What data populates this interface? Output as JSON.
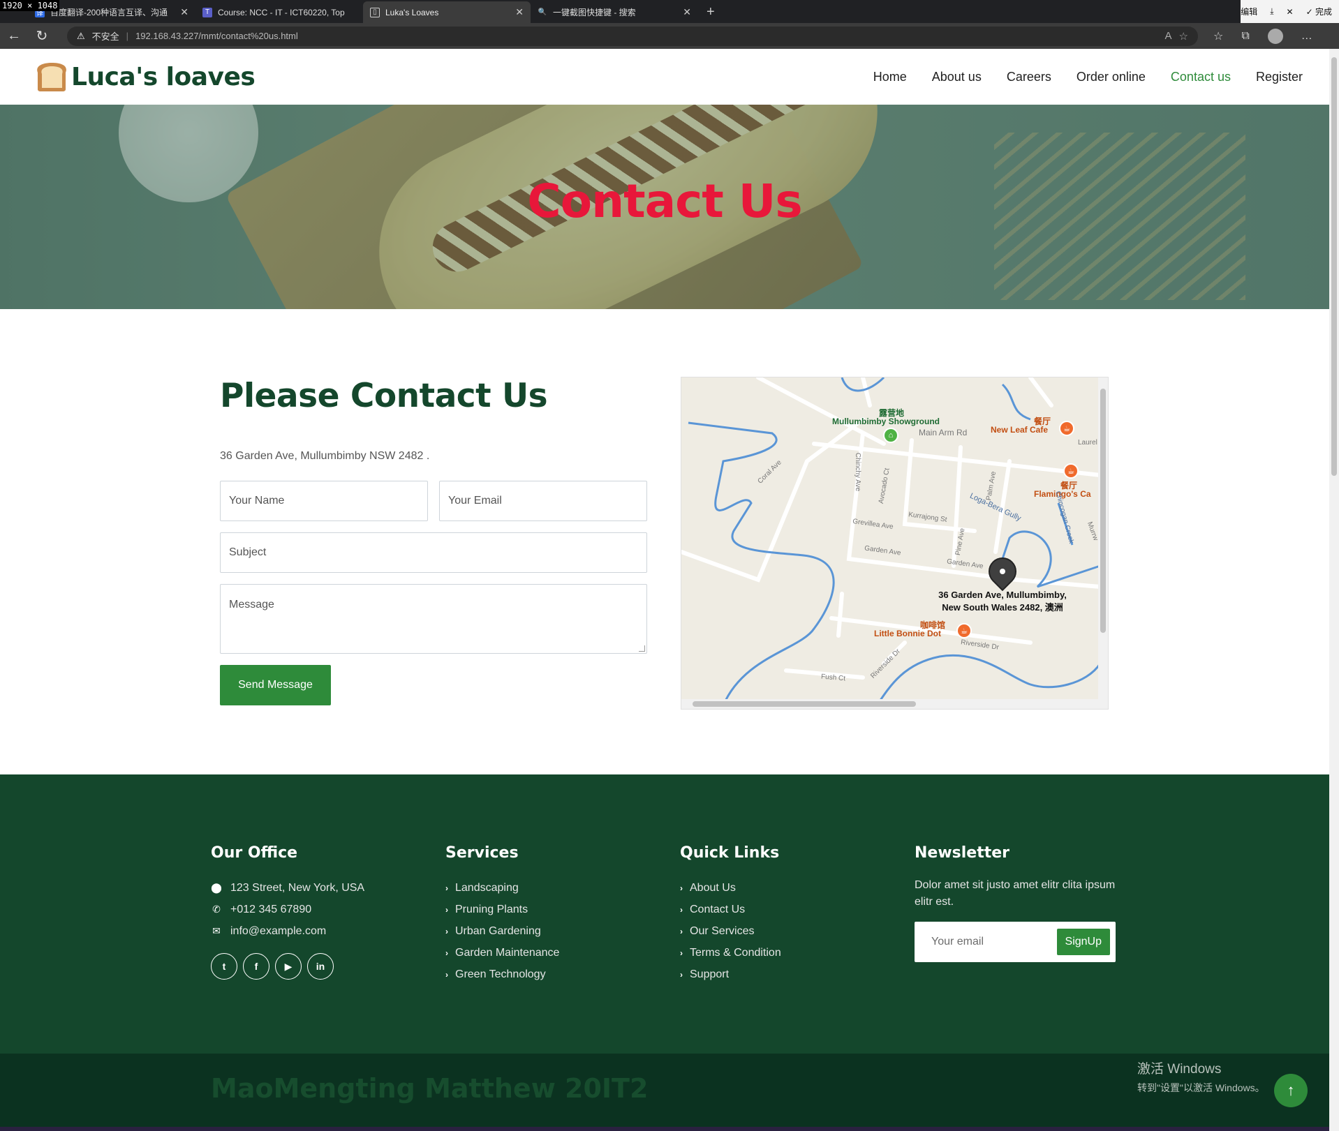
{
  "browser": {
    "dim_badge": "1920 × 1048",
    "tabs": [
      {
        "title": "百度翻译-200种语言互译、沟通",
        "icon": "baidu-icon"
      },
      {
        "title": "Course: NCC - IT - ICT60220, Top",
        "icon": "course-icon"
      },
      {
        "title": "Luka's Loaves",
        "icon": "page-icon"
      },
      {
        "title": "一键截图快捷键 - 搜索",
        "icon": "bing-search-icon"
      }
    ],
    "window_actions": {
      "edit": "编辑",
      "done": "完成"
    },
    "address": {
      "warning": "不安全",
      "url": "192.168.43.227/mmt/contact%20us.html"
    }
  },
  "site": {
    "brand": "Luca's loaves",
    "nav": [
      "Home",
      "About us",
      "Careers",
      "Order online",
      "Contact us",
      "Register"
    ],
    "active_nav": "Contact us",
    "hero_title": "Contact Us",
    "contact": {
      "heading": "Please Contact Us",
      "address": "36 Garden Ave, Mullumbimby NSW 2482 .",
      "placeholders": {
        "name": "Your Name",
        "email": "Your Email",
        "subject": "Subject",
        "message": "Message"
      },
      "send_label": "Send Message"
    },
    "map": {
      "labels": {
        "showground_cn": "露营地",
        "showground": "Mullumbimby Showground",
        "main_arm": "Main Arm Rd",
        "new_leaf_cn": "餐厅",
        "new_leaf": "New Leaf Cafe",
        "laurel": "Laurel",
        "flamingo_cn": "餐厅",
        "flamingo": "Flamingo's Ca",
        "coral": "Coral Ave",
        "chinchy": "Chinchy Ave",
        "avocado": "Avocado Ct",
        "palm": "Palm Ave",
        "kurrajong": "Kurrajong St",
        "loga": "Loga-Bera Gully",
        "grevillea": "Grevillea Ave",
        "garden1": "Garden Ave",
        "garden2": "Garden Ave",
        "pine": "Pine Ave",
        "chincogan": "Chincogan Creek",
        "murray": "Murrw",
        "dest_line1": "36 Garden Ave, Mullumbimby,",
        "dest_line2": "New South Wales 2482, 澳洲",
        "bonnie_cn": "咖啡馆",
        "bonnie": "Little Bonnie Dot",
        "riverside": "Riverside Dr",
        "riverside2": "Riverside Dr",
        "fush": "Fush Ct"
      }
    },
    "footer": {
      "office": {
        "title": "Our Office",
        "address": "123 Street, New York, USA",
        "phone": "+012 345 67890",
        "email": "info@example.com"
      },
      "services": {
        "title": "Services",
        "items": [
          "Landscaping",
          "Pruning Plants",
          "Urban Gardening",
          "Garden Maintenance",
          "Green Technology"
        ]
      },
      "quick_links": {
        "title": "Quick Links",
        "items": [
          "About Us",
          "Contact Us",
          "Our Services",
          "Terms & Condition",
          "Support"
        ]
      },
      "newsletter": {
        "title": "Newsletter",
        "text": "Dolor amet sit justo amet elitr clita ipsum elitr est.",
        "placeholder": "Your email",
        "button": "SignUp"
      },
      "copyright": "MaoMengting Matthew 20IT2"
    },
    "watermark": {
      "line1": "激活 Windows",
      "line2": "转到\"设置\"以激活 Windows。"
    }
  },
  "colors": {
    "brand_green": "#14472c",
    "accent_green": "#2e8b3a",
    "hero_title_red": "#e8173a"
  }
}
